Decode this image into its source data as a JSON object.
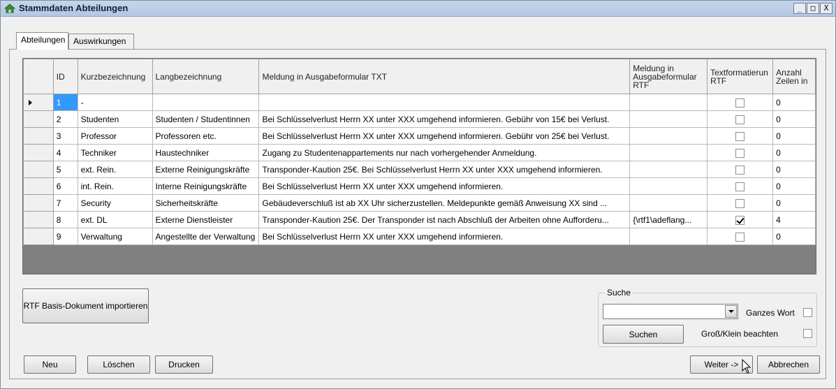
{
  "window": {
    "title": "Stammdaten Abteilungen",
    "controls": [
      "_",
      "□",
      "X"
    ]
  },
  "tabs": [
    {
      "label": "Abteilungen",
      "active": true
    },
    {
      "label": "Auswirkungen",
      "active": false
    }
  ],
  "grid": {
    "columns": [
      "ID",
      "Kurzbezeichnung",
      "Langbezeichnung",
      "Meldung in Ausgabeformular TXT",
      "Meldung in Ausgabeformular RTF",
      "Textformatierun RTF",
      "Anzahl Zeilen in"
    ],
    "rows": [
      {
        "id": "1",
        "kurz": "-",
        "lang": "",
        "txt": "",
        "rtf": "",
        "format_rtf": false,
        "zeilen": "0",
        "current": true
      },
      {
        "id": "2",
        "kurz": "Studenten",
        "lang": "Studenten / Studentinnen",
        "txt": "Bei Schlüsselverlust Herrn XX unter XXX umgehend informieren. Gebühr von 15€ bei Verlust.",
        "rtf": "",
        "format_rtf": false,
        "zeilen": "0"
      },
      {
        "id": "3",
        "kurz": "Professor",
        "lang": "Professoren etc.",
        "txt": "Bei Schlüsselverlust Herrn XX unter XXX umgehend informieren. Gebühr von 25€ bei Verlust.",
        "rtf": "",
        "format_rtf": false,
        "zeilen": "0"
      },
      {
        "id": "4",
        "kurz": "Techniker",
        "lang": "Haustechniker",
        "txt": "Zugang zu Studentenappartements nur nach vorhergehender Anmeldung.",
        "rtf": "",
        "format_rtf": false,
        "zeilen": "0"
      },
      {
        "id": "5",
        "kurz": "ext. Rein.",
        "lang": "Externe Reinigungskräfte",
        "txt": "Transponder-Kaution 25€. Bei Schlüsselverlust Herrn XX unter XXX umgehend informieren.",
        "rtf": "",
        "format_rtf": false,
        "zeilen": "0"
      },
      {
        "id": "6",
        "kurz": "int. Rein.",
        "lang": "Interne Reinigungskräfte",
        "txt": "Bei Schlüsselverlust Herrn XX unter XXX umgehend informieren.",
        "rtf": "",
        "format_rtf": false,
        "zeilen": "0"
      },
      {
        "id": "7",
        "kurz": "Security",
        "lang": "Sicherheitskräfte",
        "txt": "Gebäudeverschluß ist ab XX Uhr sicherzustellen. Meldepunkte gemäß Anweisung XX sind ...",
        "rtf": "",
        "format_rtf": false,
        "zeilen": "0"
      },
      {
        "id": "8",
        "kurz": "ext. DL",
        "lang": "Externe Dienstleister",
        "txt": "Transponder-Kaution 25€. Der Transponder ist nach Abschluß der Arbeiten ohne Aufforderu...",
        "rtf": "{\\rtf1\\adeflang...",
        "format_rtf": true,
        "zeilen": "4"
      },
      {
        "id": "9",
        "kurz": "Verwaltung",
        "lang": "Angestellte der Verwaltung",
        "txt": "Bei Schlüsselverlust Herrn XX unter XXX umgehend informieren.",
        "rtf": "",
        "format_rtf": false,
        "zeilen": "0"
      }
    ]
  },
  "buttons": {
    "rtf_import": "RTF Basis-Dokument importieren",
    "neu": "Neu",
    "loeschen": "Löschen",
    "drucken": "Drucken",
    "weiter": "Weiter ->",
    "abbrechen": "Abbrechen"
  },
  "search": {
    "group_label": "Suche",
    "input_value": "",
    "button": "Suchen",
    "ganzes_wort_label": "Ganzes Wort",
    "ganzes_wort": false,
    "gross_klein_label": "Groß/Klein beachten",
    "gross_klein": false
  },
  "colors": {
    "titlebar": "#b3c7e2",
    "selection": "#3399ff",
    "grid_background": "#808080"
  },
  "icons": {
    "window": "app-house-icon",
    "row_indicator": "current-row-arrow-icon",
    "cursor": "mouse-pointer-icon"
  }
}
